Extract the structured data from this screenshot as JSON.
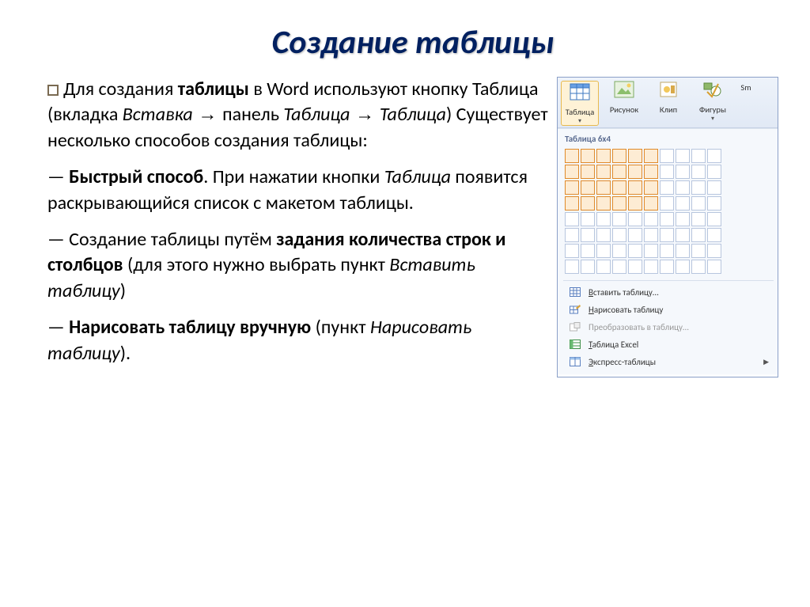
{
  "title": "Создание таблицы",
  "para1": {
    "pre": "Для создания ",
    "bold1": "таблицы",
    "mid1": " в Word используют кнопку Таблица (вкладка ",
    "ital1": "Вставка",
    "mid2": " панель ",
    "ital2": "Таблица",
    "mid3": " ",
    "ital3": "Таблица",
    "tail": ") Существует несколько способов создания таблицы:"
  },
  "para2": {
    "dash": "— ",
    "bold": "Быстрый способ",
    "mid": ". При нажатии кнопки ",
    "ital": "Таблица",
    "tail": "  появится раскрывающийся список с макетом таблицы."
  },
  "para3": {
    "dash": "— Создание таблицы путём ",
    "bold": "задания количества строк и столбцов",
    "mid": " (для этого нужно выбрать пункт ",
    "ital": "Вставить таблицу",
    "tail": ")"
  },
  "para4": {
    "dash": "— ",
    "bold": "Нарисовать таблицу вручную",
    "mid": " (пункт ",
    "ital": "Нарисовать таблицу",
    "tail": ")."
  },
  "ribbon": {
    "buttons": {
      "table": "Таблица",
      "picture": "Рисунок",
      "clip": "Клип",
      "shapes": "Фигуры",
      "smart": "Sm"
    },
    "dd_label": "Таблица 6x4",
    "menu": {
      "insert": "Вставить таблицу...",
      "draw": "Нарисовать таблицу",
      "convert": "Преобразовать в таблицу...",
      "excel": "Таблица Excel",
      "express": "Экспресс-таблицы"
    }
  }
}
